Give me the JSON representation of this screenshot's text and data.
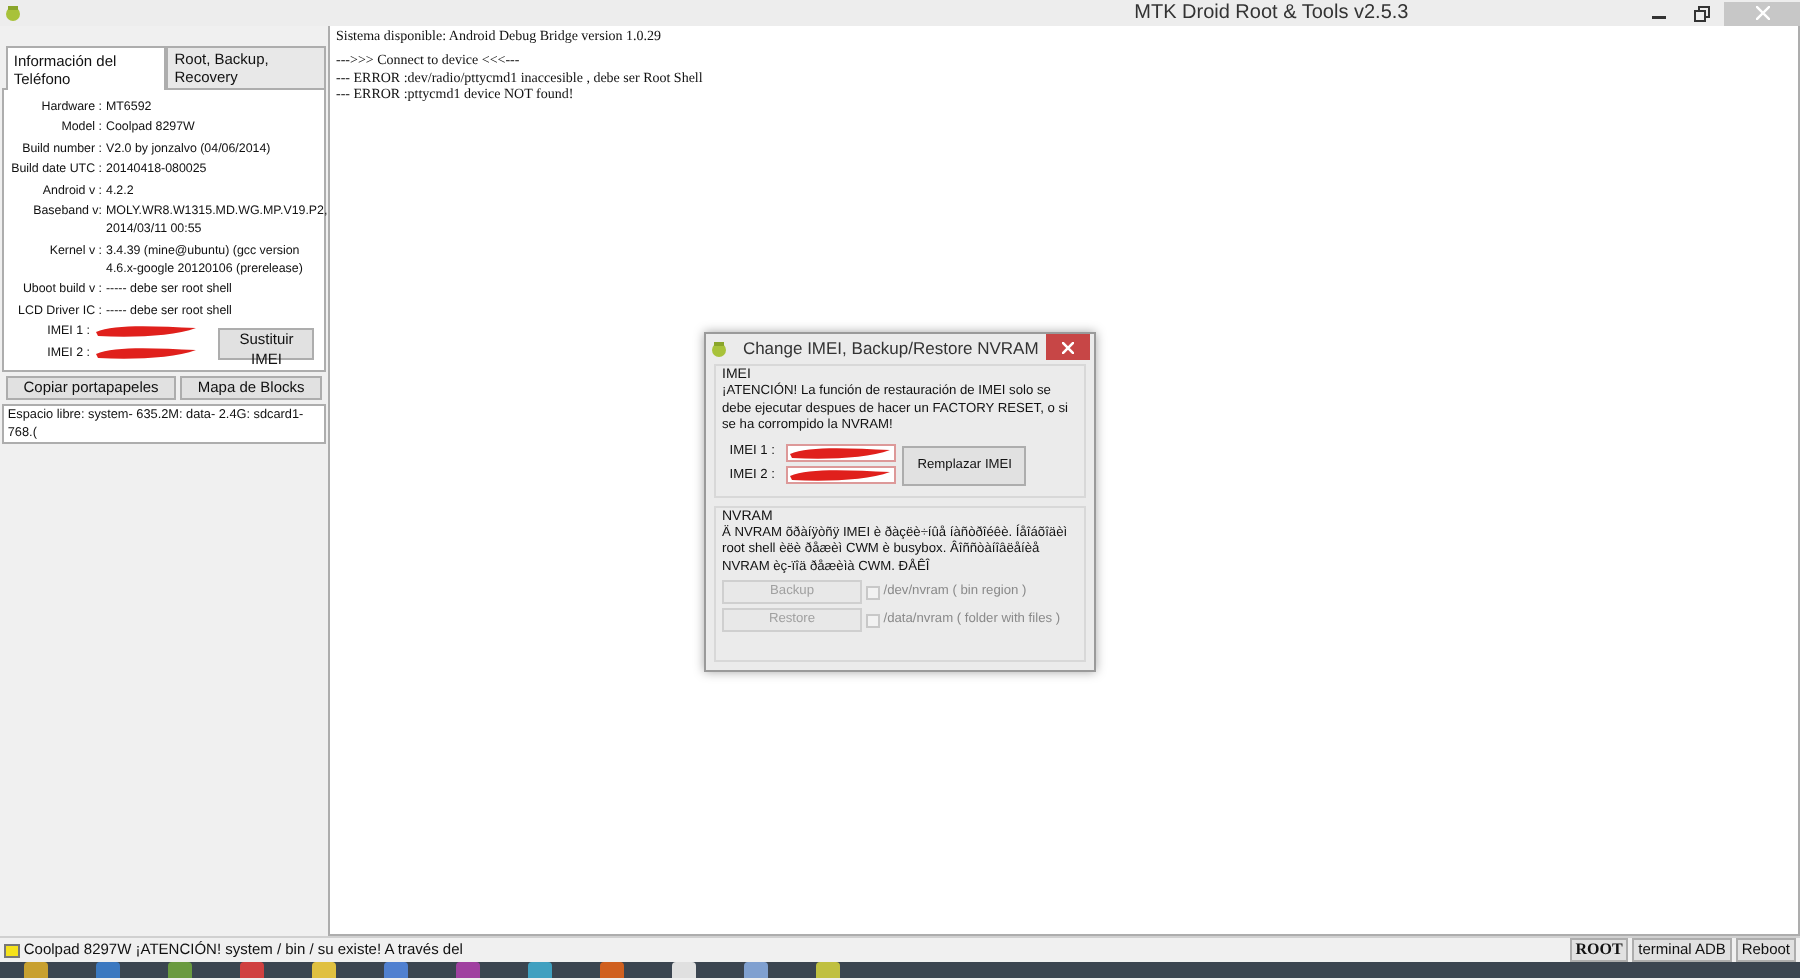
{
  "window": {
    "title": "MTK Droid Root & Tools v2.5.3"
  },
  "tabs": [
    {
      "label": "Información del Teléfono",
      "selected": true
    },
    {
      "label": "Root, Backup, Recovery",
      "selected": false
    }
  ],
  "phone_info": [
    {
      "label": "Hardware :",
      "value": "MT6592"
    },
    {
      "label": "Model :",
      "value": "Coolpad 8297W"
    },
    {
      "label": "Build number :",
      "value": "V2.0 by jonzalvo (04/06/2014)"
    },
    {
      "label": "Build date UTC :",
      "value": "20140418-080025"
    },
    {
      "label": "Android  v :",
      "value": "4.2.2"
    },
    {
      "label": "Baseband v:",
      "value": "MOLY.WR8.W1315.MD.WG.MP.V19.P2, 2014/03/11 00:55"
    },
    {
      "label": "Kernel v :",
      "value": "3.4.39 (mine@ubuntu) (gcc version 4.6.x-google 20120106 (prerelease)"
    },
    {
      "label": "Uboot build v :",
      "value": "----- debe ser  root shell"
    },
    {
      "label": "LCD Driver IC :",
      "value": "----- debe ser  root shell"
    }
  ],
  "imei_rows": [
    {
      "label": "IMEI 1 :"
    },
    {
      "label": "IMEI 2 :"
    }
  ],
  "imei_button": "Sustituir IMEI",
  "action_buttons": [
    "Copiar portapapeles",
    "Mapa de Blocks"
  ],
  "free_space": "Espacio libre: system- 635.2M: data- 2.4G: sdcard1- 768.(",
  "log_blocks": [
    [
      "Sistema disponible:  Android Debug Bridge version 1.0.29"
    ],
    [
      "--->>> Connect to device <<<---",
      "--- ERROR  :dev/radio/pttycmd1 inaccesible , debe ser  Root Shell",
      "--- ERROR  :pttycmd1 device NOT found!"
    ]
  ],
  "dialog": {
    "title": "Change IMEI, Backup/Restore NVRAM",
    "imei_group": {
      "title": "IMEI",
      "warning": "¡ATENCIÓN! La función de restauración de IMEI solo se debe ejecutar despues de hacer un FACTORY RESET, o si se ha corrompido la NVRAM!",
      "fields": [
        {
          "label": "IMEI 1 :"
        },
        {
          "label": "IMEI 2 :"
        }
      ],
      "button": "Remplazar IMEI"
    },
    "nvram_group": {
      "title": "NVRAM",
      "text": "Ä NVRAM õðàíÿòñÿ IMEI è ðàçëè÷íûå íàñòðîéêè. Íåîáõîäèì root shell èëè ðåæèì CWM è busybox. Âîññòàíîâëåíèå NVRAM èç-ïîä ðåæèìà CWM.  ÐÅÊÎ",
      "rows": [
        {
          "button": "Backup",
          "disabled": true,
          "checked": false,
          "option": "/dev/nvram  ( bin region )"
        },
        {
          "button": "Restore",
          "disabled": true,
          "checked": false,
          "option": "/data/nvram  ( folder with files )"
        }
      ]
    }
  },
  "status_bar": {
    "message": "Coolpad 8297W ¡ATENCIÓN! system / bin / su existe! A través del",
    "buttons": [
      {
        "label": "ROOT",
        "bold": true
      },
      {
        "label": "terminal ADB",
        "bold": false
      },
      {
        "label": "Reboot",
        "bold": false
      }
    ]
  }
}
